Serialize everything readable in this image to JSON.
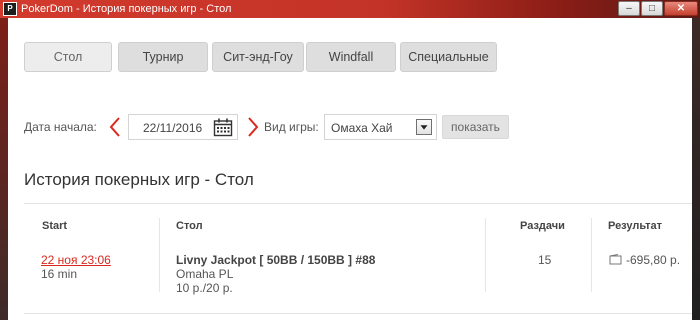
{
  "window": {
    "app_logo": "P",
    "title": "PokerDom - История покерных игр - Стол",
    "controls": [
      "minimize-icon",
      "maximize-icon",
      "close-icon"
    ]
  },
  "tabs": [
    {
      "label": "Стол",
      "active": true
    },
    {
      "label": "Турнир",
      "active": false
    },
    {
      "label": "Сит-энд-Гоу",
      "active": false
    },
    {
      "label": "Windfall",
      "active": false
    },
    {
      "label": "Специальные",
      "active": false
    }
  ],
  "filter": {
    "start_date_label": "Дата начала:",
    "start_date_value": "22/11/2016",
    "game_type_label": "Вид игры:",
    "game_type_value": "Омаха Хай",
    "show_button": "показать",
    "prev_icon": "chevron-left-icon",
    "next_icon": "chevron-right-icon",
    "calendar_icon": "calendar-icon"
  },
  "page_title": "История покерных игр - Стол",
  "table": {
    "headers": {
      "start": "Start",
      "table": "Стол",
      "hands": "Раздачи",
      "result": "Результат"
    },
    "rows": [
      {
        "start": "22 ноя 23:06",
        "duration": "16 min",
        "table_name": "Livny Jackpot [ 50BB / 150BB ] #88",
        "game": "Omaha PL",
        "stakes": "10 р./20 р.",
        "hands": "15",
        "result": "-695,80 р."
      }
    ]
  },
  "colors": {
    "accent": "#d9281c",
    "titlebar": "#c33327",
    "tab_bg": "#dedede"
  }
}
